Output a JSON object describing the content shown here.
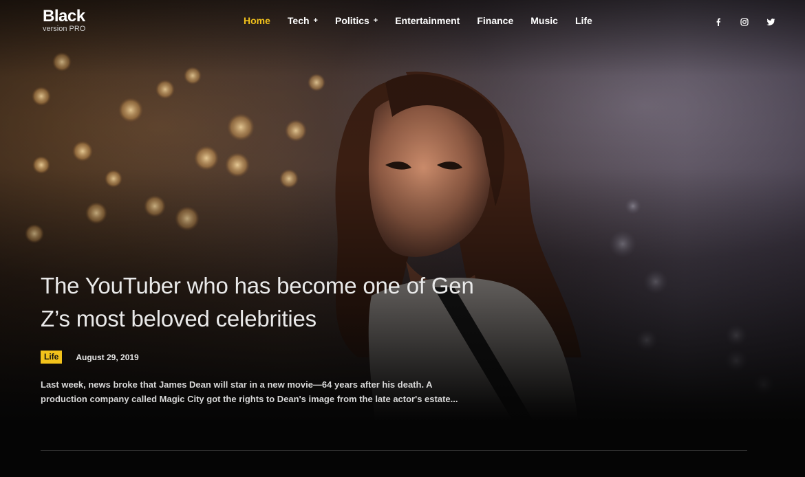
{
  "brand": {
    "title": "Black",
    "subtitle": "version PRO"
  },
  "nav": {
    "items": [
      {
        "label": "Home",
        "active": true,
        "has_submenu": false
      },
      {
        "label": "Tech",
        "active": false,
        "has_submenu": true
      },
      {
        "label": "Politics",
        "active": false,
        "has_submenu": true
      },
      {
        "label": "Entertainment",
        "active": false,
        "has_submenu": false
      },
      {
        "label": "Finance",
        "active": false,
        "has_submenu": false
      },
      {
        "label": "Music",
        "active": false,
        "has_submenu": false
      },
      {
        "label": "Life",
        "active": false,
        "has_submenu": false
      }
    ],
    "submenu_indicator": "+"
  },
  "social": [
    "facebook-icon",
    "instagram-icon",
    "twitter-icon"
  ],
  "hero": {
    "headline": "The YouTuber who has become one of Gen Z’s most beloved celebrities",
    "category": "Life",
    "date": "August 29, 2019",
    "excerpt": "Last week, news broke that James Dean will star in a new movie—64 years after his death. A production company called Magic City got the rights to Dean's image from the late actor's estate..."
  },
  "colors": {
    "accent": "#f2c21b",
    "background": "#050505",
    "text": "#ffffff"
  }
}
